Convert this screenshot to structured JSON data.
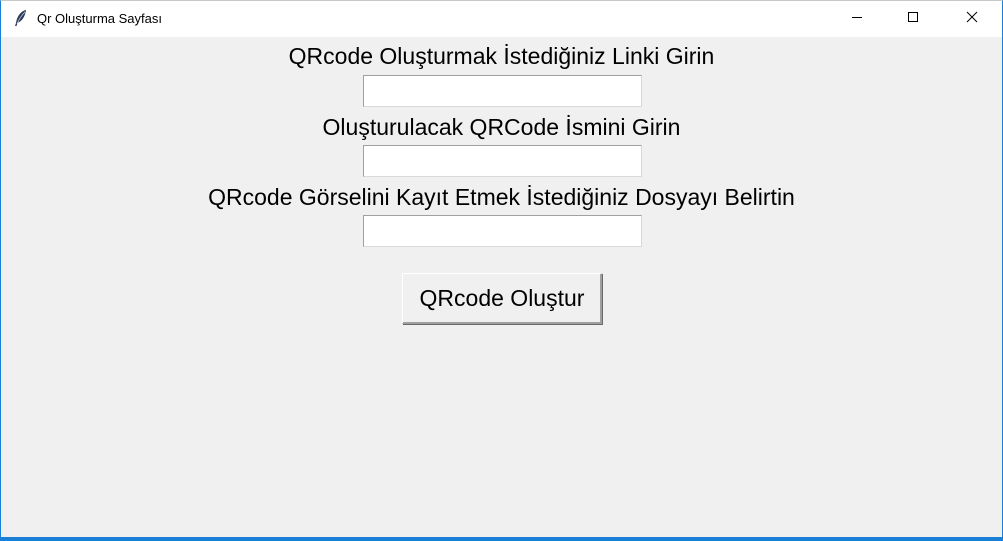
{
  "window": {
    "title": "Qr Oluşturma Sayfası",
    "icon": "feather-icon",
    "controls": [
      "minimize-icon",
      "maximize-icon",
      "close-icon"
    ],
    "accent_color": "#1a7fd6",
    "background_color": "#f0f0f0"
  },
  "form": {
    "link_label": "QRcode Oluşturmak İstediğiniz Linki Girin",
    "link_value": "",
    "name_label": "Oluşturulacak QRCode İsmini Girin",
    "name_value": "",
    "folder_label": "QRcode Görselini Kayıt Etmek İstediğiniz Dosyayı Belirtin",
    "folder_value": "",
    "submit_label": "QRcode Oluştur"
  }
}
